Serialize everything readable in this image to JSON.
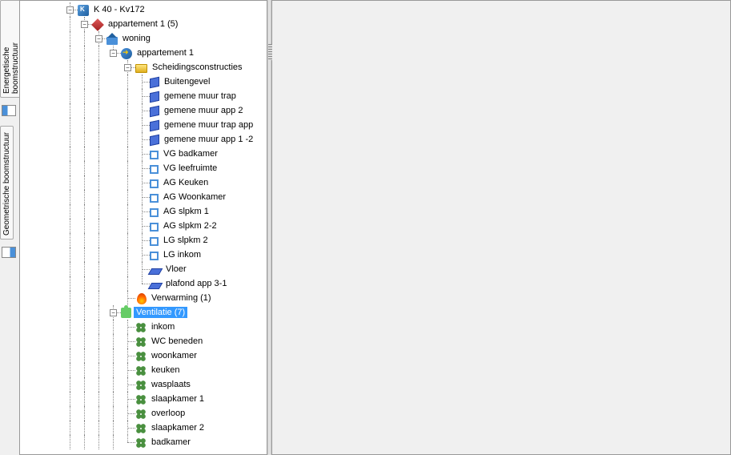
{
  "tabs": {
    "energetic": "Energetische boomstructuur",
    "geometric": "Geometrische boomstructuur"
  },
  "tree": {
    "root": "K 40 - Kv172",
    "appartement_group": "appartement 1 (5)",
    "woning": "woning",
    "appartement": "appartement 1",
    "scheidings": "Scheidingsconstructies",
    "walls": {
      "buitengevel": "Buitengevel",
      "gemene_trap": "gemene muur trap",
      "gemene_app2": "gemene muur app 2",
      "gemene_trap_app": " gemene muur trap app",
      "gemene_app12": "gemene muur app 1 -2"
    },
    "rooms_sq": {
      "vg_badkamer": "VG badkamer",
      "vg_leefruimte": "VG leefruimte",
      "ag_keuken": "AG Keuken",
      "ag_woonkamer": "AG Woonkamer",
      "ag_slpkm1": "AG slpkm 1",
      "ag_slpkm22": " AG slpkm 2-2",
      "lg_slpkm2": "LG slpkm 2",
      "lg_inkom": "LG inkom"
    },
    "floors": {
      "vloer": "Vloer",
      "plafond": "plafond app 3-1"
    },
    "verwarming": "Verwarming (1)",
    "ventilatie": "Ventilatie (7)",
    "vent_items": {
      "inkom": "inkom",
      "wc": "WC beneden",
      "woonkamer": "woonkamer",
      "keuken": "keuken",
      "wasplaats": "wasplaats",
      "slaapkamer1": "slaapkamer 1",
      "overloop": "overloop",
      "slaapkamer2": "slaapkamer 2",
      "badkamer": "badkamer"
    }
  }
}
